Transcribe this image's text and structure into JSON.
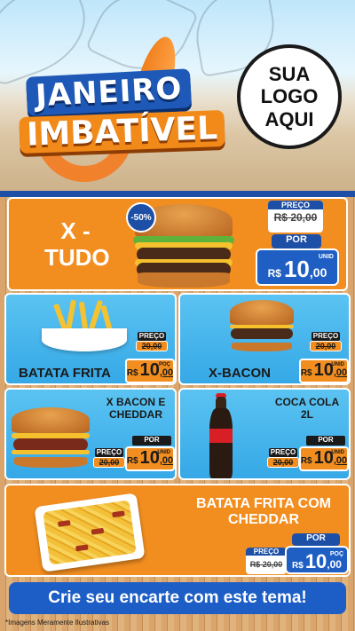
{
  "header": {
    "title_line1": "JANEIRO",
    "title_line2": "IMBATÍVEL",
    "logo_line1": "SUA",
    "logo_line2": "LOGO",
    "logo_line3": "AQUI"
  },
  "featured": {
    "name_line1": "X -",
    "name_line2": "TUDO",
    "discount_badge": "-50%",
    "old_label": "PREÇO",
    "old_price": "R$ 20,00",
    "new_label": "POR",
    "currency": "R$",
    "price_int": "10",
    "price_dec": ",00",
    "unit": "UNID"
  },
  "items": [
    {
      "name": "BATATA FRITA",
      "old_label": "PREÇO",
      "old_price": "20,00",
      "currency": "R$",
      "price_int": "10",
      "price_dec": ",00",
      "unit": "POÇ"
    },
    {
      "name": "X-BACON",
      "old_label": "PREÇO",
      "old_price": "20,00",
      "currency": "R$",
      "price_int": "10",
      "price_dec": ",00",
      "unit": "UNID"
    },
    {
      "name_line1": "X BACON E",
      "name_line2": "CHEDDAR",
      "old_label": "PREÇO",
      "old_price": "20,00",
      "new_label": "POR",
      "currency": "R$",
      "price_int": "10",
      "price_dec": ",00",
      "unit": "UNID"
    },
    {
      "name_line1": "COCA COLA",
      "name_line2": "2L",
      "old_label": "PREÇO",
      "old_price": "20,00",
      "new_label": "POR",
      "currency": "R$",
      "price_int": "10",
      "price_dec": ",00",
      "unit": "UNID"
    }
  ],
  "bottom_item": {
    "name_line1": "BATATA FRITA COM",
    "name_line2": "CHEDDAR",
    "old_label": "PREÇO",
    "old_price": "R$ 20,00",
    "new_label": "POR",
    "currency": "R$",
    "price_int": "10",
    "price_dec": ",00",
    "unit": "POÇ"
  },
  "cta": {
    "label": "Crie seu encarte com este tema!"
  },
  "footnote": "*Imagens Meramente Ilustrativas",
  "colors": {
    "orange": "#f28e20",
    "blue": "#1d4fa6",
    "sky": "#5bc3f2"
  }
}
